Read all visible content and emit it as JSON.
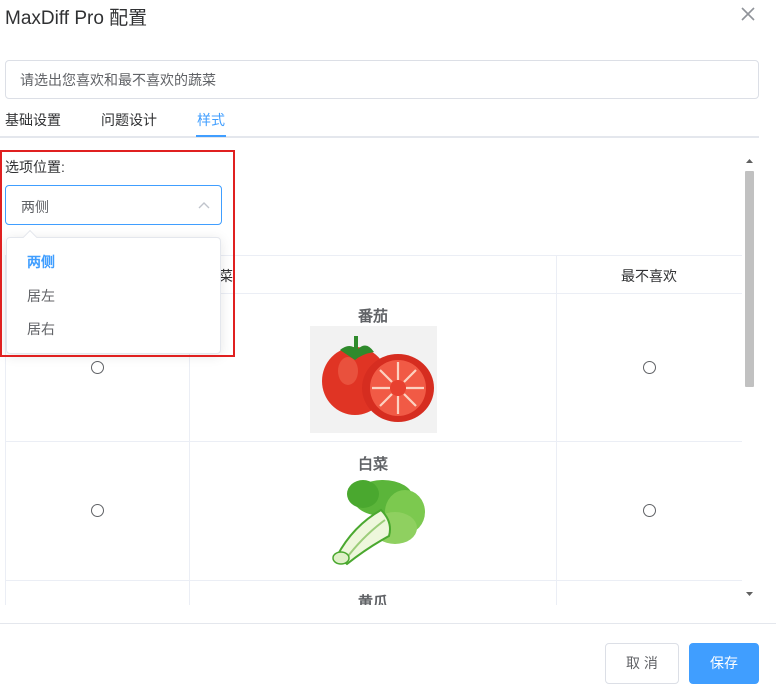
{
  "dialog": {
    "title": "MaxDiff Pro 配置",
    "close_icon": "close-icon"
  },
  "prompt": {
    "value": "请选出您喜欢和最不喜欢的蔬菜"
  },
  "tabs": [
    {
      "label": "基础设置",
      "active": false
    },
    {
      "label": "问题设计",
      "active": false
    },
    {
      "label": "样式",
      "active": true
    }
  ],
  "style_panel": {
    "option_position_label": "选项位置:",
    "select": {
      "value": "两侧",
      "arrow_icon": "chevron-up-icon",
      "options": [
        "两侧",
        "居左",
        "居右"
      ],
      "selected_index": 0
    }
  },
  "preview": {
    "columns": {
      "middle_partial": "菜",
      "least_liked": "最不喜欢"
    },
    "items": [
      {
        "name": "番茄",
        "icon": "tomato-image"
      },
      {
        "name": "白菜",
        "icon": "bok-choy-image"
      },
      {
        "name": "黄瓜",
        "icon": "cucumber-image"
      }
    ]
  },
  "colors": {
    "accent": "#409eff",
    "highlight": "#e02020"
  },
  "footer": {
    "cancel_label": "取 消",
    "save_label": "保存"
  }
}
